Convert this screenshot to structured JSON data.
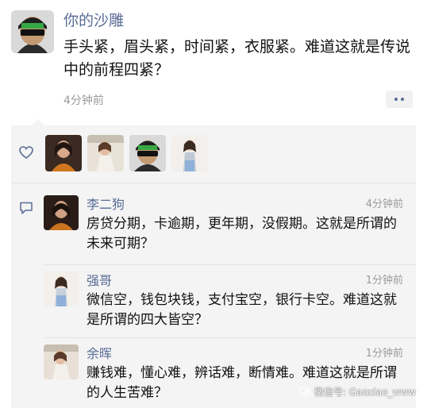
{
  "post": {
    "author": "你的沙雕",
    "text": "手头紧，眉头紧，时间紧，衣服紧。难道这就是传说中的前程四紧？",
    "time": "4分钟前"
  },
  "likes": {
    "icon": "heart-icon",
    "count_avatars": 4
  },
  "comments": [
    {
      "name": "李二狗",
      "time": "4分钟前",
      "text": "房贷分期，卡逾期，更年期，没假期。这就是所谓的未来可期？"
    },
    {
      "name": "强哥",
      "time": "1分钟前",
      "text": "微信空，钱包块钱，支付宝空，银行卡空。难道这就是所谓的四大皆空？"
    },
    {
      "name": "余晖",
      "time": "1分钟前",
      "text": "赚钱难，懂心难，辨话难，断情难。难道这就是所谓的人生苦难？"
    }
  ],
  "watermark": {
    "text": "微信号: Gaoxiao_www"
  },
  "colors": {
    "name_link": "#576b95",
    "panel_bg": "#f4f4f4",
    "time_gray": "#9b9b9b"
  }
}
